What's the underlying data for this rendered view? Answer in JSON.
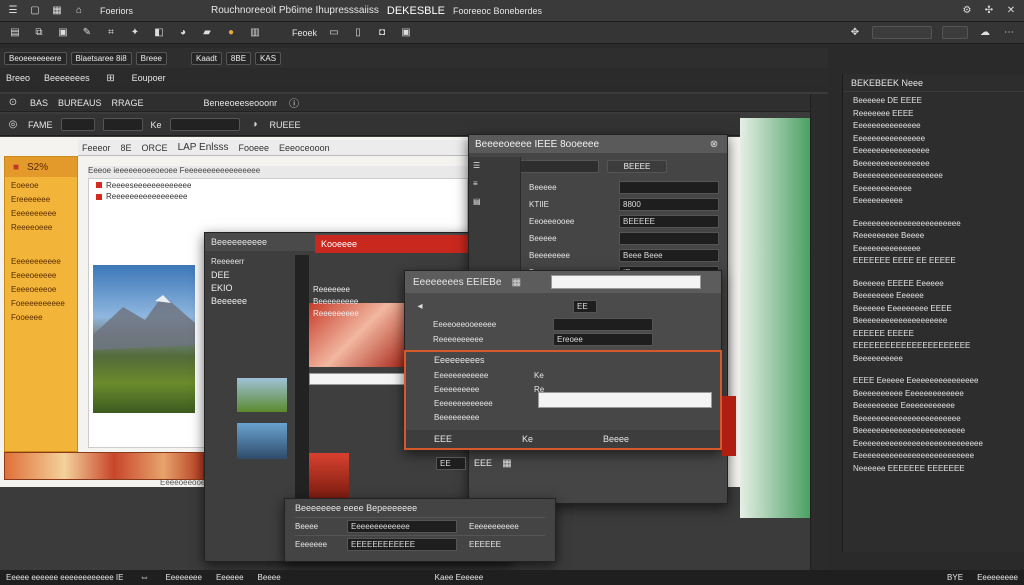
{
  "menubar": {
    "left_label": "Foeriors",
    "title": "Rouchnoreeoit Pb6ime Ihupresssaiiss",
    "title_badge": "DEKESBLE",
    "right_label": "Fooreeoc Boneberdes"
  },
  "toolbar2": {
    "label": "Feoek"
  },
  "tabs": {
    "t1": "Beoeeeeeeere",
    "t2": "Blaetsaree 8i8",
    "t3": "Breee",
    "t4": "Kaadt",
    "t5": "8BE",
    "t6": "KAS"
  },
  "strip3": {
    "a": "Breeo",
    "b": "Beeeeeees",
    "c": "Eoupoer",
    "d": "Beneeoeeseooonr"
  },
  "strip4": {
    "a": "BAS",
    "b": "BUREAUS",
    "c": "RRAGE",
    "d": "FAME",
    "e": "Ke",
    "f": "RUEEE"
  },
  "doc": {
    "tab_a": "Feeeor",
    "tab_b": "8E",
    "tab_c": "ORCE",
    "tab_d": "LAP Enlsss",
    "tab_e": "Fooeee",
    "tab_f": "Eeeoceooon",
    "ruler": "Eeeoe ieeeeeeoeeoeoee  Feeeeeeeeeeeeeeeee",
    "heading": "Reeeeseeeeeeeeeeeee",
    "subheading": "Reeeeeeeeeeeeeeeee",
    "footer": "Eeeeoeeooee"
  },
  "yellow_panel": {
    "title": "S2%",
    "items": [
      "Eoeeoe",
      "Ereeeeeee",
      "Eeeeeeeeee",
      "Reeeeoeee",
      "Eeeeeeeeeee",
      "Eeeeoeeeee",
      "Eeeeoeeeoe",
      "Foeeeeeeeeee",
      "Fooeeee"
    ]
  },
  "red_dialog": {
    "title": "Beeeeeeeeee",
    "btn": "Kooeeee",
    "left_title": "Reeeeerr",
    "left_items": [
      "DEE",
      "EKIO",
      "Beeeeee"
    ],
    "panel_items": [
      "Reeeeeee",
      "Beeeeeeeee",
      "Reeeeeeeee"
    ]
  },
  "dark_dialog": {
    "title": "Beeeeoeeee IEEE 8ooeeee",
    "btn": "BEEEE",
    "rows": [
      {
        "label": "Beeeee",
        "value": ""
      },
      {
        "label": "KTIIE",
        "value": "8800"
      },
      {
        "label": "Eeoeeeooee",
        "value": "BEEEEE"
      },
      {
        "label": "Beeeee",
        "value": ""
      },
      {
        "label": "Beeeeeeee",
        "value": "Beee Beee"
      },
      {
        "label": "Beeeee",
        "value": "IE"
      }
    ]
  },
  "front_dialog": {
    "title": "Eeeeeeees EEIEBe",
    "field_label": "EE",
    "rows": [
      {
        "label": "Eeeeoeeooeeeee",
        "value": ""
      },
      {
        "label": "Reeeeeeeeee",
        "value": "Ereoee"
      }
    ],
    "sub_title": "Eeeeeeeees",
    "sub_rows": [
      {
        "label": "Eeeeeeeeeeee",
        "value": "Ke"
      },
      {
        "label": "Eeeeeeeeee",
        "value": "Re"
      },
      {
        "label": "Eeeeeeeeeeeee",
        "value": ""
      },
      {
        "label": "Beeeeeeeee",
        "value": ""
      }
    ],
    "footer_a": "EEE",
    "footer_b": "Ke",
    "footer_c": "Beeee"
  },
  "small_bar": {
    "a": "EE",
    "b": "EEE"
  },
  "bottom_panel": {
    "title": "Beeeeeeee eeee Bepeeeeeee",
    "rows": [
      {
        "a": "Beeee",
        "b": "Eeeeeeeeeeeee",
        "c": "Eeeeeeeeeee"
      },
      {
        "a": "Eeeeeee",
        "b": "EEEEEEEEEEEE",
        "c": "EEEEEE"
      }
    ]
  },
  "right_panel": {
    "header": "BEKEBEEK Neee",
    "lines": [
      "Beeeeee   DE EEEE",
      "Reeeeeee  EEEE",
      "Eeeeeeeeeeeeeee",
      "Eeeeeeeeeeeeeeee",
      "Eeeeeeeeeeeeeeeee",
      "Beeeeeeeeeeeeeeee",
      "Beeeeeeeeeeeeeeeeeee",
      "Eeeeeeeeeeeee",
      "Eeeeeeeeeee",
      "Eeeeeeeeeeeeeeeeeeeeeeee",
      "Reeeeeeeee Beeee",
      "Eeeeeeeeeeeeeee",
      "EEEEEEE EEEE  EE EEEEE",
      "Beeeeee EEEEE  Eeeeee",
      "Beeeeeeee Eeeeee",
      "Beeeeee Eeeeeeeee EEEE",
      "Beeeeeeeeeeeeeeeeeeee",
      "EEEEEE EEEEE",
      "EEEEEEEEEEEEEEEEEEEEEE",
      "Beeeeeeeeee",
      "EEEE Eeeeee Eeeeeeeeeeeeeeee",
      "Beeeeeeeeee Eeeeeeeeeeeee",
      "Beeeeeeeee Eeeeeeeeeeee",
      "Beeeeeeeeeeeeeeeeeeeeeee",
      "Beeeeeeeeeeeeeeeeeeeeeeee",
      "Eeeeeeeeeeeeeeeeeeeeeeeeeeeee",
      "Eeeeeeeeeeeeeeeeeeeeeeeeeee",
      "Neeeeee  EEEEEEE EEEEEEE"
    ]
  },
  "statusbar": {
    "left": "Eeeee eeeeee eeeeeeeeeeee IE",
    "mid1": "Eeeeeeee",
    "mid2": "Eeeeee",
    "mid3": "Beeee",
    "center": "Kaee Eeeeee",
    "right1": "BYE",
    "right2": "Eeeeeeeee"
  },
  "colors": {
    "accent": "#d62a1e",
    "panel": "#484848",
    "bg": "#2a2a2a",
    "yellow": "#f2b53a"
  }
}
